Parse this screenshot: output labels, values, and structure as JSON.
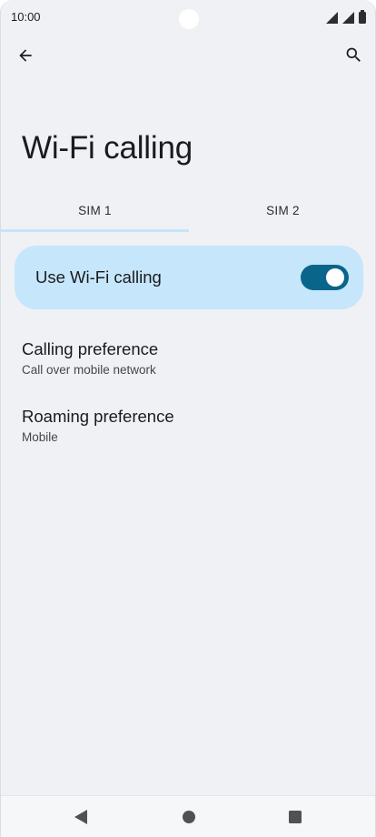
{
  "status_bar": {
    "time": "10:00",
    "icons": [
      "signal-icon",
      "signal-icon",
      "battery-icon"
    ]
  },
  "toolbar": {
    "back_icon": "arrow-left-icon",
    "search_icon": "search-icon"
  },
  "page": {
    "title": "Wi-Fi calling"
  },
  "tabs": [
    {
      "label": "SIM 1",
      "selected": true
    },
    {
      "label": "SIM 2",
      "selected": false
    }
  ],
  "main_switch": {
    "label": "Use Wi-Fi calling",
    "checked": true
  },
  "preferences": [
    {
      "title": "Calling preference",
      "summary": "Call over mobile network"
    },
    {
      "title": "Roaming preference",
      "summary": "Mobile"
    }
  ],
  "nav_bar": {
    "icons": [
      "nav-back-icon",
      "nav-home-icon",
      "nav-recents-icon"
    ]
  },
  "colors": {
    "background": "#eff1f4",
    "switch_bar": "#c6e6fb",
    "toggle_on": "#09658a",
    "tab_indicator": "#c4e5fa"
  }
}
